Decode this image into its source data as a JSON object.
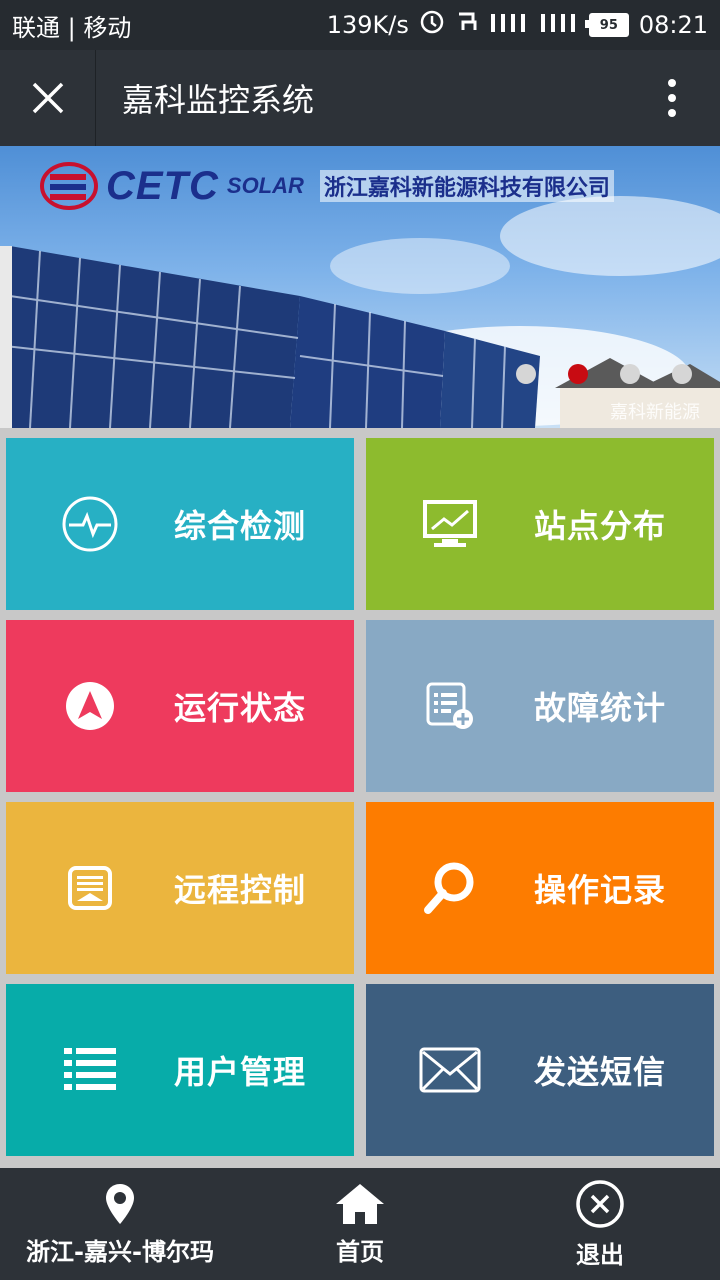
{
  "status_bar": {
    "carrier": "联通 | 移动",
    "speed": "139K/s",
    "battery": "95",
    "time": "08:21"
  },
  "title_bar": {
    "title": "嘉科监控系统",
    "close_icon": "close-icon",
    "more_icon": "more-vertical-icon"
  },
  "banner": {
    "logo_cetc": "CETC",
    "logo_solar": "SOLAR",
    "company": "浙江嘉科新能源科技有限公司",
    "watermark": "嘉科新能源",
    "slides": 4,
    "active_slide": 2
  },
  "tiles": [
    {
      "label": "综合检测",
      "icon": "pulse-monitor-icon",
      "color": "#27b0c4"
    },
    {
      "label": "站点分布",
      "icon": "monitor-chart-icon",
      "color": "#8dbb2e"
    },
    {
      "label": "运行状态",
      "icon": "navigation-arrow-icon",
      "color": "#ee3a5d"
    },
    {
      "label": "故障统计",
      "icon": "list-add-icon",
      "color": "#88a9c4"
    },
    {
      "label": "远程控制",
      "icon": "remote-panel-icon",
      "color": "#ebb53e"
    },
    {
      "label": "操作记录",
      "icon": "search-icon",
      "color": "#fd7c00"
    },
    {
      "label": "用户管理",
      "icon": "list-icon",
      "color": "#07aca9"
    },
    {
      "label": "发送短信",
      "icon": "mail-icon",
      "color": "#3d5e7f"
    }
  ],
  "bottom_bar": {
    "location": "浙江-嘉兴-博尔玛",
    "home": "首页",
    "exit": "退出"
  }
}
